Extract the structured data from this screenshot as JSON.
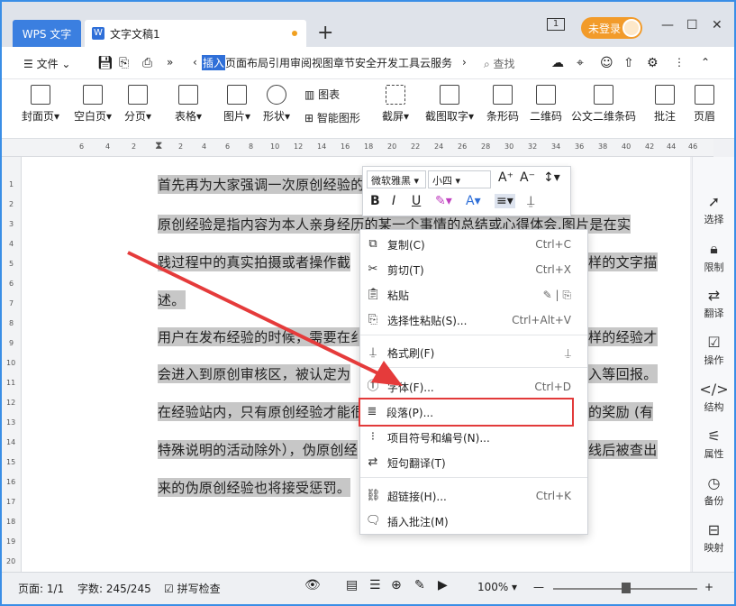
{
  "titlebar": {
    "app_tab": "WPS 文字",
    "doc_tab": "文字文稿1",
    "doc_icon": "W",
    "new_tab": "+",
    "login": "未登录",
    "window_counter": "1"
  },
  "menubar": {
    "file": "文件",
    "tabs_active": "插入",
    "tabs_rest": "页面布局引用审阅视图章节安全开发工具云服务",
    "search": "查找"
  },
  "ribbon": {
    "items": [
      "封面页",
      "空白页",
      "分页",
      "表格",
      "图片",
      "形状",
      "截屏",
      "截图取字",
      "条形码",
      "二维码",
      "公文二维条码",
      "批注",
      "页眉"
    ],
    "chart": "图表",
    "smart_shape": "智能图形"
  },
  "ruler": {
    "h_ticks": [
      "6",
      "4",
      "2",
      "2",
      "4",
      "6",
      "8",
      "10",
      "12",
      "14",
      "16",
      "18",
      "20",
      "22",
      "24",
      "26",
      "28",
      "30",
      "32",
      "34",
      "36",
      "38",
      "40",
      "42",
      "44",
      "46"
    ],
    "v_ticks": [
      "1",
      "2",
      "3",
      "4",
      "5",
      "6",
      "7",
      "8",
      "9",
      "10",
      "11",
      "12",
      "13",
      "14",
      "15",
      "16",
      "17",
      "18",
      "19",
      "20"
    ]
  },
  "document": {
    "lines": [
      "首先再为大家强调一次原创经验的",
      "原创经验是指内容为本人亲身经历的某一个事情的总结或心得体会,图片是在实",
      "践过程中的真实拍摄或者操作截",
      "述。",
      "用户在发布经验的时候，需要在纟",
      "会进入到原创审核区，被认定为",
      "在经验站内，只有原创经验才能很",
      "特殊说明的活动除外），伪原创经",
      "来的伪原创经验也将接受惩罚。"
    ],
    "right_fragments": [
      "样的文字描",
      "样的经验才",
      "入等回报。",
      "的奖励 (有",
      "线后被查出"
    ]
  },
  "mini_toolbar": {
    "font": "微软雅黑",
    "size": "小四"
  },
  "context_menu": {
    "items": [
      {
        "label": "复制(C)",
        "shortcut": "Ctrl+C",
        "icon": "copy-icon"
      },
      {
        "label": "剪切(T)",
        "shortcut": "Ctrl+X",
        "icon": "scissors-icon"
      },
      {
        "label": "粘贴",
        "shortcut": "",
        "icon": "paste-icon"
      },
      {
        "label": "选择性粘贴(S)...",
        "shortcut": "Ctrl+Alt+V",
        "icon": "paste-special-icon"
      },
      {
        "label": "格式刷(F)",
        "shortcut": "",
        "icon": "format-brush-icon"
      },
      {
        "label": "字体(F)...",
        "shortcut": "Ctrl+D",
        "icon": "font-icon"
      },
      {
        "label": "段落(P)...",
        "shortcut": "",
        "icon": "paragraph-icon"
      },
      {
        "label": "项目符号和编号(N)...",
        "shortcut": "",
        "icon": "bullets-icon"
      },
      {
        "label": "短句翻译(T)",
        "shortcut": "",
        "icon": "translate-icon"
      },
      {
        "label": "超链接(H)...",
        "shortcut": "Ctrl+K",
        "icon": "link-icon"
      },
      {
        "label": "插入批注(M)",
        "shortcut": "",
        "icon": "comment-icon"
      }
    ]
  },
  "right_panel": [
    "选择",
    "限制",
    "翻译",
    "操作",
    "结构",
    "属性",
    "备份",
    "映射"
  ],
  "statusbar": {
    "page": "页面: 1/1",
    "words": "字数: 245/245",
    "spell": "拼写检查",
    "zoom": "100%"
  },
  "colors": {
    "accent": "#2f6fd8",
    "highlight_box": "#e23a3a",
    "arrow": "#e53b3b"
  }
}
